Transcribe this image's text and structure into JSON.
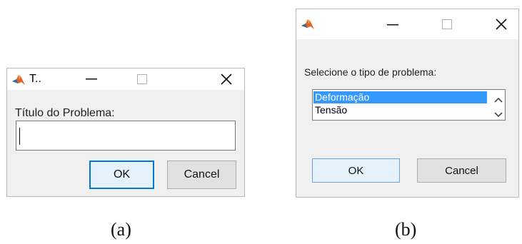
{
  "dialog_a": {
    "title": "T..",
    "prompt_label": "Título do Problema:",
    "input_value": "",
    "ok_label": "OK",
    "cancel_label": "Cancel",
    "caption": "(a)"
  },
  "dialog_b": {
    "title": "",
    "prompt_label": "Selecione o tipo de problema:",
    "options": [
      "Deformação",
      "Tensão"
    ],
    "selected_option": "Deformação",
    "ok_label": "OK",
    "cancel_label": "Cancel",
    "caption": "(b)"
  },
  "icons": {
    "app": "matlab-logo-icon",
    "minimize": "minimize-icon",
    "maximize": "maximize-icon",
    "close": "close-icon",
    "scroll_up": "chevron-up-icon",
    "scroll_down": "chevron-down-icon"
  },
  "colors": {
    "selection": "#3399ff",
    "default_button_border": "#0078d7",
    "default_button_fill": "#e5f1fb"
  }
}
